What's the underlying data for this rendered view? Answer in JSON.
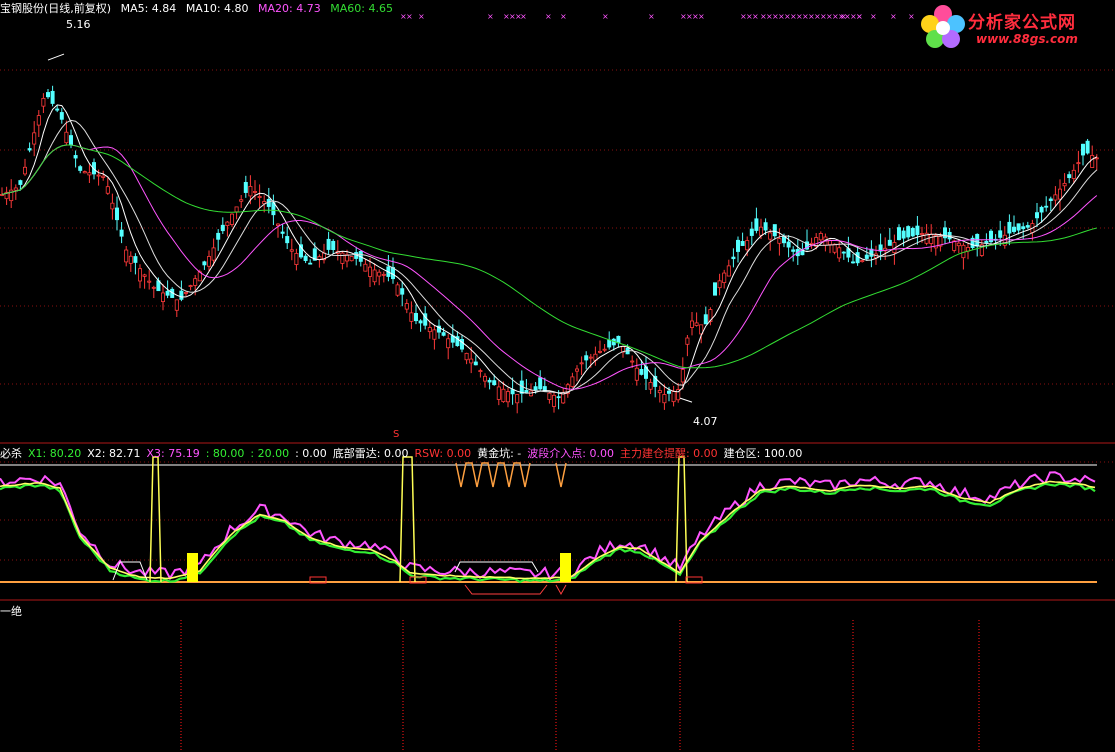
{
  "header": {
    "title": "宝钢股份(日线,前复权)",
    "ma": [
      {
        "label": "MA5: 4.84",
        "color": "#ffffff"
      },
      {
        "label": "MA10: 4.80",
        "color": "#ffffff"
      },
      {
        "label": "MA20: 4.73",
        "color": "#ff55ff"
      },
      {
        "label": "MA60: 4.65",
        "color": "#33dd33"
      }
    ]
  },
  "price_panel": {
    "high_label": "5.16",
    "low_label": "4.07",
    "price_min": 4.0,
    "price_max": 5.25
  },
  "indicator_bar": [
    {
      "label": "必杀",
      "color": "#ffffff"
    },
    {
      "label": "X1: 80.20",
      "color": "#33ee33"
    },
    {
      "label": "X2: 82.71",
      "color": "#ffffff"
    },
    {
      "label": "X3: 75.19",
      "color": "#ff55ff"
    },
    {
      "label": ": 80.00",
      "color": "#33ee33"
    },
    {
      "label": ": 20.00",
      "color": "#33ee33"
    },
    {
      "label": ": 0.00",
      "color": "#ffffff"
    },
    {
      "label": "底部雷达: 0.00",
      "color": "#ffffff"
    },
    {
      "label": "RSW: 0.00",
      "color": "#ff3333"
    },
    {
      "label": "黄金坑: -",
      "color": "#ffffff"
    },
    {
      "label": "波段介入点: 0.00",
      "color": "#ff55ff"
    },
    {
      "label": "主力建仓提醒: 0.00",
      "color": "#ff3333"
    },
    {
      "label": "建仓区: 100.00",
      "color": "#ffffff"
    }
  ],
  "indicator_s_label": "S",
  "panel3_label": "一绝",
  "logo": {
    "brand": "分析家公式网",
    "url": "www.88gs.com"
  },
  "chart_data": [
    {
      "type": "candlestick",
      "title": "宝钢股份(日线,前复权)",
      "y_range": [
        4.0,
        5.25
      ],
      "annotations": [
        {
          "text": "5.16",
          "value": 5.16
        },
        {
          "text": "4.07",
          "value": 4.07
        }
      ],
      "series": [
        {
          "name": "MA5",
          "last": 4.84,
          "color": "#ffffff"
        },
        {
          "name": "MA10",
          "last": 4.8,
          "color": "#ffffff"
        },
        {
          "name": "MA20",
          "last": 4.73,
          "color": "#ff55ff"
        },
        {
          "name": "MA60",
          "last": 4.65,
          "color": "#33dd33"
        }
      ],
      "grid": true
    },
    {
      "type": "line",
      "title": "必杀",
      "series": [
        {
          "name": "X1",
          "last": 80.2,
          "color": "#33ee33"
        },
        {
          "name": "X2",
          "last": 82.71,
          "color": "#ffffff"
        },
        {
          "name": "X3",
          "last": 75.19,
          "color": "#ff55ff"
        }
      ],
      "reference_lines": [
        80.0,
        20.0,
        0.0
      ],
      "markers": [
        "底部雷达",
        "RSW",
        "黄金坑",
        "波段介入点",
        "主力建仓提醒",
        "建仓区"
      ]
    }
  ]
}
